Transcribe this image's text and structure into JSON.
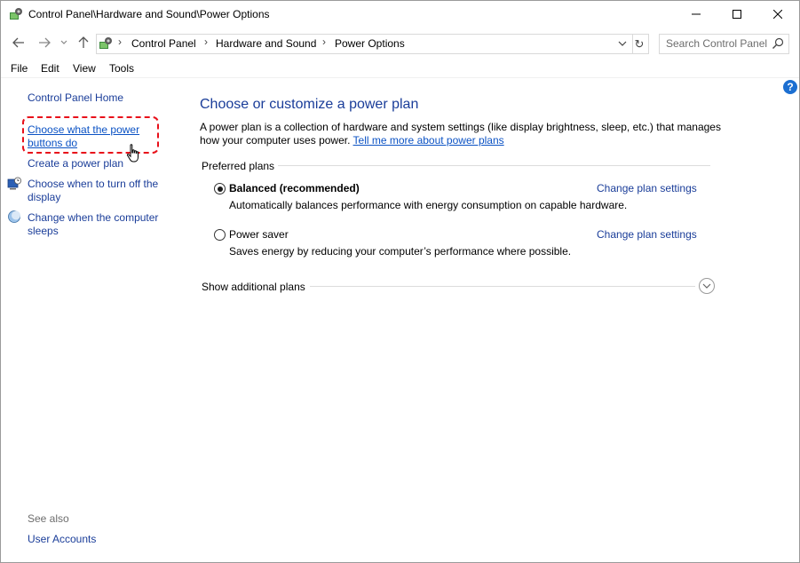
{
  "window": {
    "title": "Control Panel\\Hardware and Sound\\Power Options"
  },
  "address": {
    "crumbs": [
      "Control Panel",
      "Hardware and Sound",
      "Power Options"
    ],
    "search_placeholder": "Search Control Panel"
  },
  "menu": {
    "items": [
      "File",
      "Edit",
      "View",
      "Tools"
    ]
  },
  "sidebar": {
    "home": "Control Panel Home",
    "links": [
      {
        "label_line1": "Choose what the power",
        "label_line2": "buttons do"
      },
      {
        "label": "Create a power plan"
      },
      {
        "label_line1": "Choose when to turn off the",
        "label_line2": "display"
      },
      {
        "label_line1": "Change when the computer",
        "label_line2": "sleeps"
      }
    ],
    "see_also": "See also",
    "user_accounts": "User Accounts"
  },
  "main": {
    "heading": "Choose or customize a power plan",
    "description_line1": "A power plan is a collection of hardware and system settings (like display brightness, sleep, etc.) that manages",
    "description_line2": "how your computer uses power.",
    "learn_more": "Tell me more about power plans",
    "preferred_label": "Preferred plans",
    "plans": [
      {
        "name": "Balanced (recommended)",
        "description": "Automatically balances performance with energy consumption on capable hardware.",
        "link": "Change plan settings",
        "selected": true
      },
      {
        "name": "Power saver",
        "description": "Saves energy by reducing your computer’s performance where possible.",
        "link": "Change plan settings",
        "selected": false
      }
    ],
    "additional_label": "Show additional plans",
    "help_glyph": "?"
  },
  "colors": {
    "link": "#1a3d99",
    "link_underlined": "#0b52c4",
    "highlight": "#e8101a",
    "help_badge": "#1c6fd1"
  }
}
